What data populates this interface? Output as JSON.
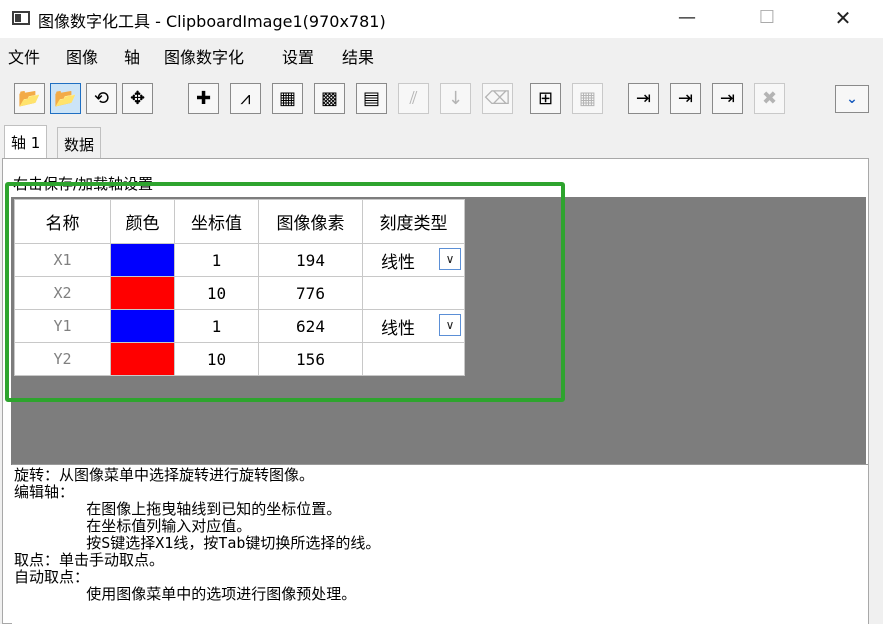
{
  "window": {
    "title": "图像数字化工具 - ClipboardImage1(970x781)",
    "minimize": "—",
    "maximize": "☐",
    "close": "✕"
  },
  "menu": [
    "文件",
    "图像",
    "轴",
    "图像数字化",
    "设置",
    "结果"
  ],
  "toolbar": {
    "buttons": [
      {
        "icon": "open-folder-icon",
        "glyph": "📂"
      },
      {
        "icon": "open-folder-active-icon",
        "glyph": "📂"
      },
      {
        "icon": "rotate-image-icon",
        "glyph": "⟲"
      },
      {
        "icon": "move-axes-icon",
        "glyph": "✥"
      },
      {
        "icon": "pick-point-icon",
        "glyph": "✚"
      },
      {
        "icon": "auto-trace-icon",
        "glyph": "⩘"
      },
      {
        "icon": "region-grid-icon",
        "glyph": "▦"
      },
      {
        "icon": "grid-select-icon",
        "glyph": "▩"
      },
      {
        "icon": "grid-select-alt-icon",
        "glyph": "▤"
      },
      {
        "icon": "line-disabled-icon",
        "glyph": "⫽"
      },
      {
        "icon": "sort-disabled-icon",
        "glyph": "↓"
      },
      {
        "icon": "eraser-disabled-icon",
        "glyph": "⌫"
      },
      {
        "icon": "data-frame-icon",
        "glyph": "⊞"
      },
      {
        "icon": "table-disabled-icon",
        "glyph": "▦"
      },
      {
        "icon": "send-to-book-icon",
        "glyph": "⇥"
      },
      {
        "icon": "send-to-graph-icon",
        "glyph": "⇥"
      },
      {
        "icon": "send-to-plot-icon",
        "glyph": "⇥"
      },
      {
        "icon": "delete-disabled-icon",
        "glyph": "✖"
      },
      {
        "icon": "chevron-down-icon",
        "glyph": "⌄"
      }
    ]
  },
  "tabs": [
    "轴 1",
    "数据"
  ],
  "panel": {
    "hint": "右击保存/加载轴设置"
  },
  "axes_table": {
    "headers": [
      "名称",
      "颜色",
      "坐标值",
      "图像像素",
      "刻度类型"
    ],
    "rows": [
      {
        "name": "X1",
        "color": "#0000ff",
        "value": "1",
        "pixel": "194",
        "scale": "线性"
      },
      {
        "name": "X2",
        "color": "#ff0000",
        "value": "10",
        "pixel": "776",
        "scale": ""
      },
      {
        "name": "Y1",
        "color": "#0000ff",
        "value": "1",
        "pixel": "624",
        "scale": "线性"
      },
      {
        "name": "Y2",
        "color": "#ff0000",
        "value": "10",
        "pixel": "156",
        "scale": ""
      }
    ]
  },
  "help": {
    "lines": [
      "旋转：从图像菜单中选择旋转进行旋转图像。",
      "编辑轴：",
      "        在图像上拖曳轴线到已知的坐标位置。",
      "        在坐标值列输入对应值。",
      "        按S键选择X1线，按Tab键切换所选择的线。",
      "取点：单击手动取点。",
      "自动取点：",
      "        使用图像菜单中的选项进行图像预处理。"
    ]
  },
  "colors": {
    "highlight": "#2ea42e",
    "canvas": "#7d7d7d"
  }
}
